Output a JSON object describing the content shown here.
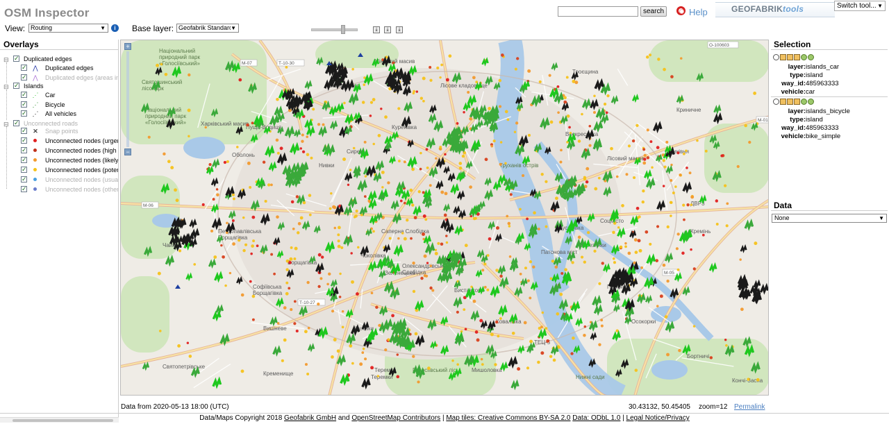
{
  "header": {
    "title": "OSM Inspector",
    "search_button": "search",
    "search_value": "",
    "help": "Help",
    "brand_main": "GEOFABRIK",
    "brand_tools": "tools",
    "switch_tool": "Switch tool..."
  },
  "toolbar": {
    "view_label": "View:",
    "view_value": "Routing",
    "baselayer_label": "Base layer:",
    "baselayer_value": "Geofabrik Standard"
  },
  "overlays": {
    "title": "Overlays",
    "groups": [
      {
        "label": "Duplicated edges",
        "items": [
          "Duplicated edges",
          "Duplicated edges (areas in"
        ]
      },
      {
        "label": "Islands",
        "items": [
          "Car",
          "Bicycle",
          "All vehicles"
        ]
      },
      {
        "label": "Unconnected roads",
        "items": [
          "Snap points",
          "Unconnected nodes (urger",
          "Unconnected nodes (high",
          "Unconnected nodes (likely",
          "Unconnected nodes (poter",
          "Unconnected nodes (usual",
          "Unconnected nodes (other"
        ]
      }
    ]
  },
  "map": {
    "labels": [
      "Національний природний парк «Голосіївський»",
      "Святошинський лісопарк",
      "Національний природний парк «Голосіївський»",
      "Мінський масив",
      "Виноградар",
      "Пуща-Водиця",
      "Троєщина",
      "Куренівка",
      "Сирець",
      "Нивки",
      "Оболонь",
      "Воскресенка",
      "Биківня",
      "Лісовий масив",
      "Русанівка",
      "ДВРЗ",
      "Соцмісто",
      "Березняки",
      "Петропавлівська Борщагівка",
      "Чайки",
      "Борщагівка",
      "Софіївська Борщагівка",
      "Вишневе",
      "Жуляни",
      "Голосіївський ліс",
      "Мишоловка",
      "Теремки",
      "Позняки",
      "Осокорки",
      "Бортничі",
      "Труханів острів",
      "Патонова міст",
      "Святопетрівське",
      "Кременище",
      "Нижні сади",
      "Кончі-Заспа",
      "Харківський масив",
      "Саперна Слобідка",
      "Чоколівка",
      "Олександрівська Слобідка",
      "Теремки",
      "Зеленецька",
      "Виставкова",
      "Криничне",
      "Лісове кладовище",
      "ТЕЦ-5",
      "Ковалівка",
      "Кремінь"
    ],
    "road_refs": [
      "М-07",
      "Т-10-30",
      "О-100603",
      "М-01",
      "М-06",
      "Т-10-27",
      "М-05"
    ]
  },
  "status": {
    "date": "Data from 2020-05-13 18:00 (UTC)",
    "coords": "30.43132, 50.45405",
    "zoom": "zoom=12",
    "permalink": "Permalink"
  },
  "footer": {
    "prefix": "Data/Maps Copyright 2018",
    "geofabrik": "Geofabrik GmbH",
    "and": "and",
    "osm": "OpenStreetMap Contributors",
    "tiles": "Map tiles: Creative Commons BY-SA 2.0",
    "data": "Data: ODbL 1.0",
    "legal": "Legal Notice/Privacy"
  },
  "selection": {
    "title": "Selection",
    "items": [
      {
        "layer": "islands_car",
        "type": "island",
        "way_id": "485963333",
        "vehicle": "car"
      },
      {
        "layer": "islands_bicycle",
        "type": "island",
        "way_id": "485963333",
        "vehicle": "bike_simple"
      }
    ],
    "keys": {
      "layer": "layer:",
      "type": "type:",
      "way_id": "way_id:",
      "vehicle": "vehicle:"
    }
  },
  "data_panel": {
    "title": "Data",
    "select_value": "None"
  },
  "colors": {
    "car": "#3aa93a",
    "bicycle": "#1ec81e",
    "all_vehicles": "#1a1a1a",
    "urgent": "#e0201f",
    "high": "#d8401c",
    "likely": "#f29a2e",
    "potential": "#f6c21a",
    "usually": "#4aa0e0",
    "other": "#6a7ccc",
    "brand": "#6ea3d6"
  }
}
